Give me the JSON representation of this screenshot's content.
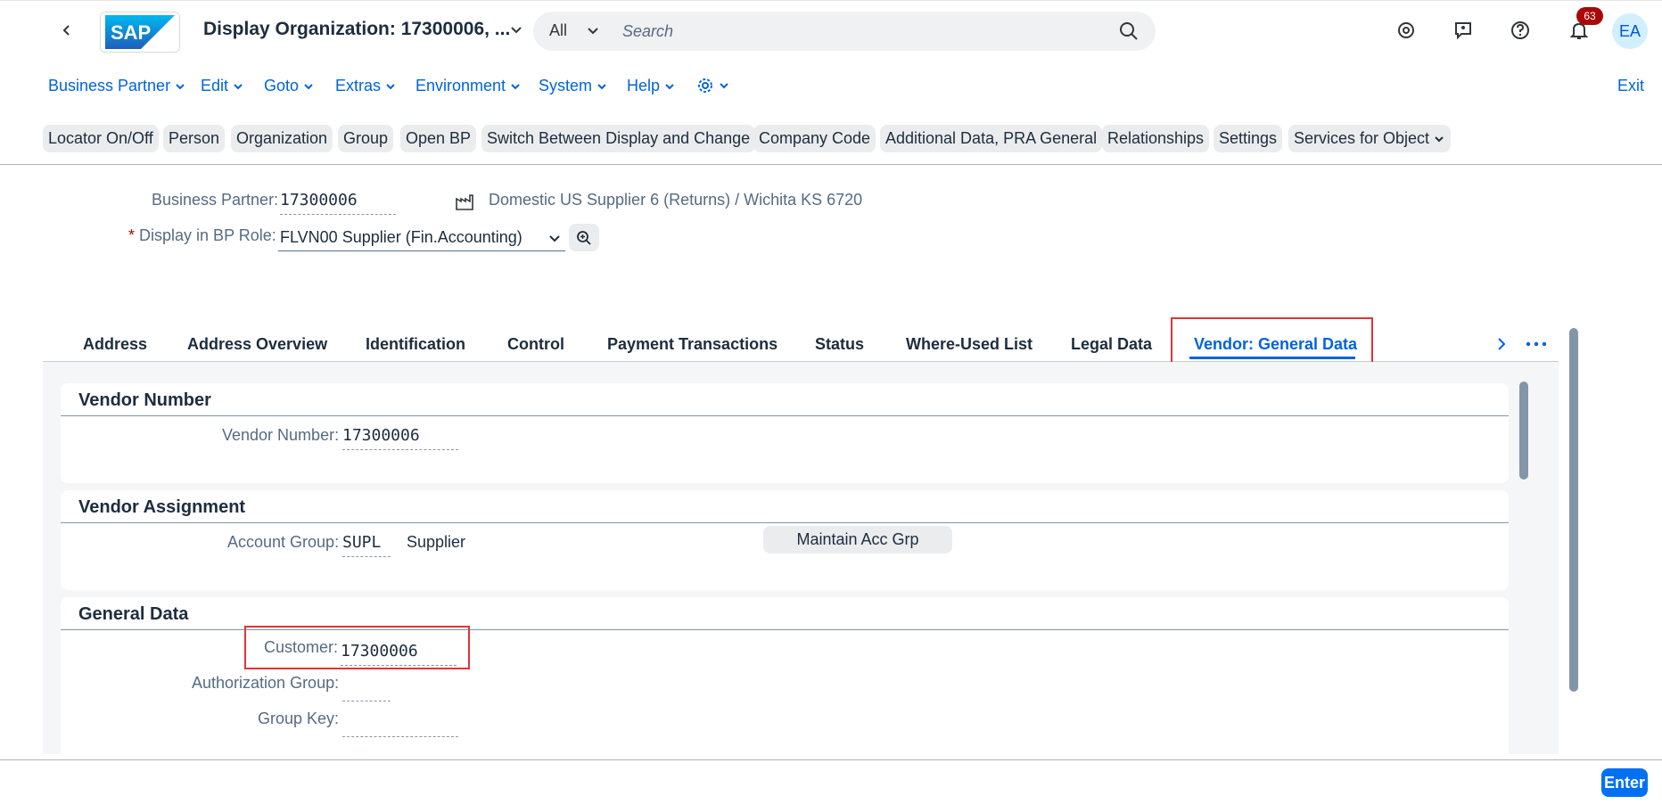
{
  "shell": {
    "title": "Display Organization: 17300006, ...",
    "search_scope": "All",
    "search_placeholder": "Search",
    "notification_count": "63",
    "avatar_initials": "EA",
    "logo_text": "SAP"
  },
  "menu": {
    "items": [
      "Business Partner",
      "Edit",
      "Goto",
      "Extras",
      "Environment",
      "System",
      "Help"
    ],
    "exit_label": "Exit"
  },
  "toolbar": {
    "buttons": [
      "Locator On/Off",
      "Person",
      "Organization",
      "Group",
      "Open BP",
      "Switch Between Display and Change",
      "Company Code",
      "Additional Data, PRA General",
      "Relationships",
      "Settings",
      "Services for Object"
    ]
  },
  "header": {
    "bp_label": "Business Partner:",
    "bp_value": "17300006",
    "bp_description": "Domestic US Supplier 6 (Returns) / Wichita KS 6720",
    "role_required": "*",
    "role_label": "Display in BP Role:",
    "role_value": "FLVN00 Supplier (Fin.Accounting)"
  },
  "tabs": {
    "items": [
      "Address",
      "Address Overview",
      "Identification",
      "Control",
      "Payment Transactions",
      "Status",
      "Where-Used List",
      "Legal Data",
      "Vendor: General Data"
    ],
    "active": "Vendor: General Data"
  },
  "vendor_number": {
    "title": "Vendor Number",
    "label": "Vendor Number:",
    "value": "17300006"
  },
  "vendor_assignment": {
    "title": "Vendor Assignment",
    "label": "Account Group:",
    "value": "SUPL",
    "description": "Supplier",
    "button": "Maintain Acc Grp"
  },
  "general_data": {
    "title": "General Data",
    "customer_label": "Customer:",
    "customer_value": "17300006",
    "auth_group_label": "Authorization Group:",
    "auth_group_value": "",
    "group_key_label": "Group Key:",
    "group_key_value": ""
  },
  "footer": {
    "enter_label": "Enter"
  },
  "colors": {
    "accent": "#0064d9",
    "highlight": "#e03535",
    "badge": "#aa0808"
  }
}
